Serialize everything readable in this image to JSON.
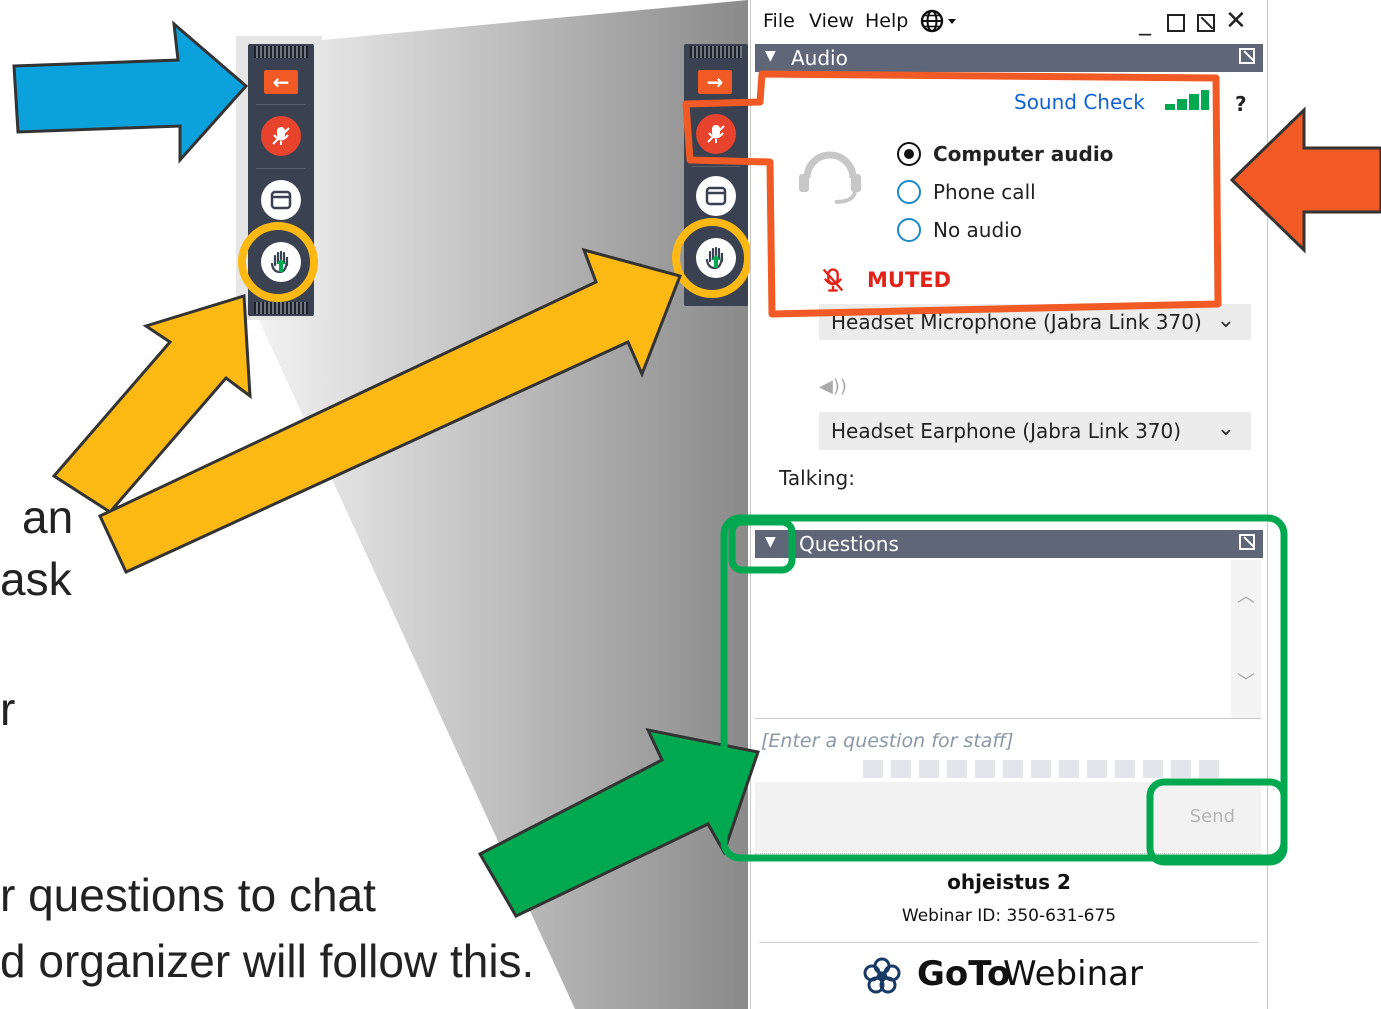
{
  "slide": {
    "left_text_lines": [
      "an",
      "ask",
      "r"
    ],
    "bottom_text_lines": [
      "r questions to chat",
      "d organizer will follow this."
    ]
  },
  "toolbar": {
    "collapse_arrow": "←",
    "expand_arrow": "→"
  },
  "panel": {
    "menu": [
      "File",
      "View",
      "Help"
    ],
    "audio": {
      "header": "Audio",
      "sound_check": "Sound Check",
      "help": "?",
      "options": [
        {
          "label": "Computer audio",
          "selected": true
        },
        {
          "label": "Phone call",
          "selected": false
        },
        {
          "label": "No audio",
          "selected": false
        }
      ],
      "status": "MUTED",
      "microphone": "Headset Microphone (Jabra Link 370)",
      "speaker": "Headset Earphone (Jabra Link 370)",
      "talking_label": "Talking:"
    },
    "questions": {
      "header": "Questions",
      "placeholder": "[Enter a question for staff]",
      "send_label": "Send"
    },
    "footer": {
      "title": "ohjeistus 2",
      "webinar_id": "Webinar ID: 350-631-675",
      "brand_bold": "GoTo",
      "brand_light": "Webinar"
    }
  },
  "colors": {
    "blue_arrow": "#0aa1dc",
    "orange_arrow": "#f15a24",
    "yellow_arrow": "#fdb913",
    "green_arrow": "#00a84f",
    "muted_red": "#e2231a",
    "link_blue": "#0f62d6"
  }
}
